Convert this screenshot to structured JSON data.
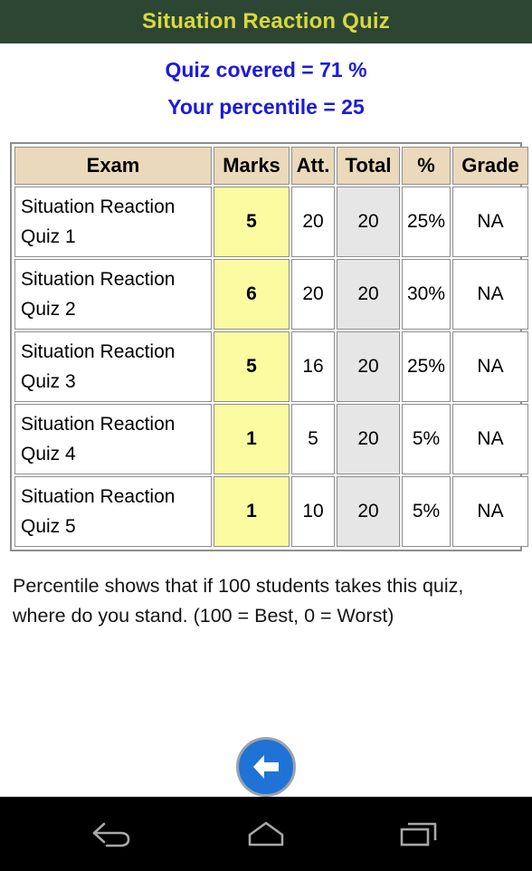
{
  "titlebar": {
    "title": "Situation Reaction Quiz"
  },
  "summary": {
    "quiz_covered": "Quiz covered = 71 %",
    "your_percentile": "Your percentile = 25"
  },
  "table": {
    "headers": {
      "exam": "Exam",
      "marks": "Marks",
      "att": "Att.",
      "total": "Total",
      "pct": "%",
      "grade": "Grade"
    },
    "rows": [
      {
        "exam": "Situation Reaction Quiz 1",
        "marks": "5",
        "att": "20",
        "total": "20",
        "pct": "25%",
        "grade": "NA"
      },
      {
        "exam": "Situation Reaction Quiz 2",
        "marks": "6",
        "att": "20",
        "total": "20",
        "pct": "30%",
        "grade": "NA"
      },
      {
        "exam": "Situation Reaction Quiz 3",
        "marks": "5",
        "att": "16",
        "total": "20",
        "pct": "25%",
        "grade": "NA"
      },
      {
        "exam": "Situation Reaction Quiz 4",
        "marks": "1",
        "att": "5",
        "total": "20",
        "pct": "5%",
        "grade": "NA"
      },
      {
        "exam": "Situation Reaction Quiz 5",
        "marks": "1",
        "att": "10",
        "total": "20",
        "pct": "5%",
        "grade": "NA"
      }
    ]
  },
  "note": {
    "text": "Percentile shows that if 100 students takes this quiz, where do you stand. (100 = Best, 0 = Worst)"
  },
  "back_button": {
    "icon": "arrow-left-icon"
  },
  "navbar": {
    "back": "back-icon",
    "home": "home-icon",
    "recents": "recents-icon"
  },
  "colors": {
    "titlebar_bg": "#2d4634",
    "titlebar_text": "#d7d93f",
    "summary_text": "#1a1ae0",
    "header_cell_bg": "#ead9bb",
    "marks_cell_bg": "#fafaa0",
    "marks_cell_text": "#1a7a1a",
    "total_cell_bg": "#e6e6e6",
    "back_button_bg": "#1f73d4",
    "navbar_bg": "#000000"
  }
}
